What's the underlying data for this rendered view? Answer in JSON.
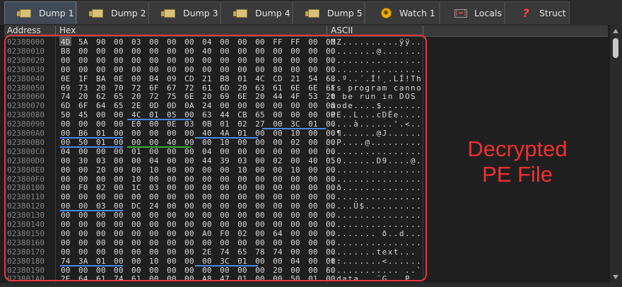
{
  "tabs": [
    {
      "label": "Dump 1",
      "icon": "dump-icon",
      "active": true
    },
    {
      "label": "Dump 2",
      "icon": "dump-icon"
    },
    {
      "label": "Dump 3",
      "icon": "dump-icon"
    },
    {
      "label": "Dump 4",
      "icon": "dump-icon"
    },
    {
      "label": "Dump 5",
      "icon": "dump-icon"
    },
    {
      "label": "Watch 1",
      "icon": "watch-icon"
    },
    {
      "label": "Locals",
      "icon": "locals-icon"
    },
    {
      "label": "Struct",
      "icon": "struct-icon"
    }
  ],
  "columns": {
    "address": "Address",
    "hex": "Hex",
    "ascii": "ASCII"
  },
  "rows": [
    {
      "address": "02380000",
      "hex": "4D 5A 90 00 03 00 00 00 04 00 00 00 FF FF 00 00",
      "ascii": "MZ..........ÿÿ.."
    },
    {
      "address": "02380010",
      "hex": "B8 00 00 00 00 00 00 00 40 00 00 00 00 00 00 00",
      "ascii": "........@......."
    },
    {
      "address": "02380020",
      "hex": "00 00 00 00 00 00 00 00 00 00 00 00 00 00 00 00",
      "ascii": "................"
    },
    {
      "address": "02380030",
      "hex": "00 00 00 00 00 00 00 00 00 00 00 00 80 00 00 00",
      "ascii": "................"
    },
    {
      "address": "02380040",
      "hex": "0E 1F BA 0E 00 B4 09 CD 21 B8 01 4C CD 21 54 68",
      "ascii": "..º..´.Í!¸.LÍ!Th"
    },
    {
      "address": "02380050",
      "hex": "69 73 20 70 72 6F 67 72 61 6D 20 63 61 6E 6E 6F",
      "ascii": "is program canno"
    },
    {
      "address": "02380060",
      "hex": "74 20 62 65 20 72 75 6E 20 69 6E 20 44 4F 53 20",
      "ascii": "t be run in DOS "
    },
    {
      "address": "02380070",
      "hex": "6D 6F 64 65 2E 0D 0D 0A 24 00 00 00 00 00 00 00",
      "ascii": "mode....$......."
    },
    {
      "address": "02380080",
      "hex": "50 45 00 00 4C 01 05 00 63 44 CB 65 00 00 00 00",
      "ascii": "PE..L...cDËe...."
    },
    {
      "address": "02380090",
      "hex": "00 00 00 00 E0 00 0E 03 0B 01 02 27 00 3C 01 00",
      "ascii": "....à......'.<.."
    },
    {
      "address": "023800A0",
      "hex": "00 B6 01 00 00 00 00 00 40 4A 01 00 00 10 00 00",
      "ascii": ".¶......@J......"
    },
    {
      "address": "023800B0",
      "hex": "00 50 01 00 00 00 40 00 00 10 00 00 00 02 00 00",
      "ascii": ".P....@........."
    },
    {
      "address": "023800C0",
      "hex": "04 00 00 00 01 00 00 00 04 00 00 00 00 00 00 00",
      "ascii": "................"
    },
    {
      "address": "023800D0",
      "hex": "00 30 03 00 00 04 00 00 44 39 03 00 02 00 40 05",
      "ascii": ".0......D9....@."
    },
    {
      "address": "023800E0",
      "hex": "00 00 20 00 00 10 00 00 00 00 10 00 00 10 00 00",
      "ascii": "................"
    },
    {
      "address": "023800F0",
      "hex": "00 00 00 00 10 00 00 00 00 00 00 00 00 00 00 00",
      "ascii": "................"
    },
    {
      "address": "02380100",
      "hex": "00 F0 02 00 1C 03 00 00 00 00 00 00 00 00 00 00",
      "ascii": ".ð.............."
    },
    {
      "address": "02380110",
      "hex": "00 00 00 00 00 00 00 00 00 00 00 00 00 00 00 00",
      "ascii": "................"
    },
    {
      "address": "02380120",
      "hex": "00 00 03 00 DC 24 00 00 00 00 00 00 00 00 00 00",
      "ascii": "....Ü$.........."
    },
    {
      "address": "02380130",
      "hex": "00 00 00 00 00 00 00 00 00 00 00 00 00 00 00 00",
      "ascii": "................"
    },
    {
      "address": "02380140",
      "hex": "00 00 00 00 00 00 00 00 00 00 00 00 00 00 00 00",
      "ascii": "................"
    },
    {
      "address": "02380150",
      "hex": "00 00 00 00 00 00 00 00 A0 F0 02 00 64 00 00 00",
      "ascii": "........ ð..d..."
    },
    {
      "address": "02380160",
      "hex": "00 00 00 00 00 00 00 00 00 00 00 00 00 00 00 00",
      "ascii": "................"
    },
    {
      "address": "02380170",
      "hex": "00 00 00 00 00 00 00 00 2E 74 65 78 74 00 00 00",
      "ascii": "........text..."
    },
    {
      "address": "02380180",
      "hex": "74 3A 01 00 00 10 00 00 00 3C 01 00 00 04 00 00",
      "ascii": "t:.......<......"
    },
    {
      "address": "02380190",
      "hex": "00 00 00 00 00 00 00 00 00 00 00 00 20 00 00 60",
      "ascii": "............ ..`"
    },
    {
      "address": "023801A0",
      "hex": "2E 64 61 74 61 00 00 00 A8 47 01 00 00 50 01 00",
      "ascii": ".data...¨G...P.."
    }
  ],
  "annotation": {
    "line1": "Decrypted",
    "line2": "PE File"
  },
  "colors": {
    "annotation": "#f03030",
    "frame": "#e8383c",
    "underline_blue": "#4a88e8",
    "underline_green": "#38b038"
  }
}
